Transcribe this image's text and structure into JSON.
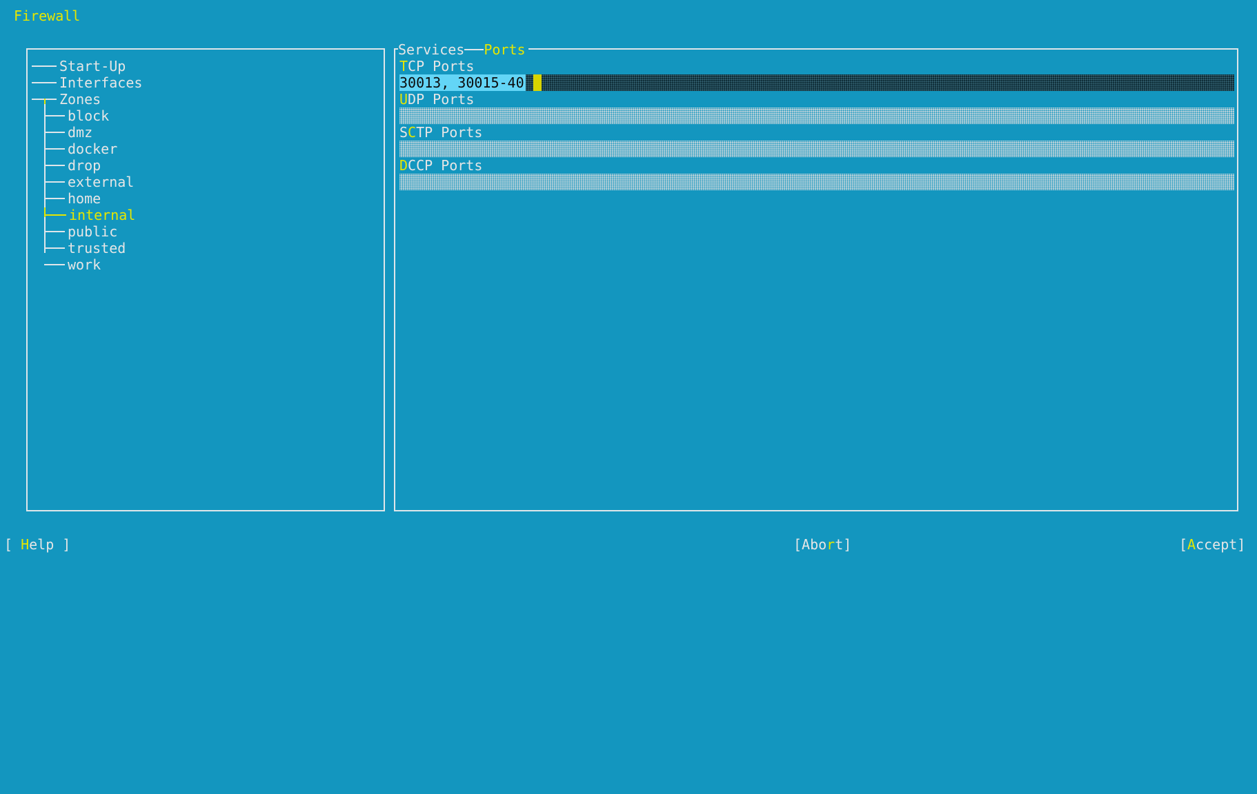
{
  "app": {
    "title": "Firewall"
  },
  "tree": {
    "top_items": [
      {
        "label": "Start-Up"
      },
      {
        "label": "Interfaces"
      },
      {
        "label": "Zones"
      }
    ],
    "zones": [
      {
        "label": "block"
      },
      {
        "label": "dmz"
      },
      {
        "label": "docker"
      },
      {
        "label": "drop"
      },
      {
        "label": "external"
      },
      {
        "label": "home"
      },
      {
        "label": "internal",
        "selected": true
      },
      {
        "label": "public"
      },
      {
        "label": "trusted"
      },
      {
        "label": "work"
      }
    ]
  },
  "tabs": {
    "services": "Services",
    "ports": "Ports",
    "active": "Ports"
  },
  "ports": {
    "tcp": {
      "hotkey": "T",
      "label_rest": "CP Ports",
      "value": "30013, 30015-40"
    },
    "udp": {
      "hotkey": "U",
      "label_rest": "DP Ports",
      "value": ""
    },
    "sctp": {
      "pre": "S",
      "hotkey": "C",
      "label_rest": "TP Ports",
      "value": ""
    },
    "dccp": {
      "hotkey": "D",
      "label_rest": "CCP Ports",
      "value": ""
    }
  },
  "buttons": {
    "help": {
      "open": "[ ",
      "hotkey": "H",
      "rest": "elp ]"
    },
    "abort": {
      "open": "[Abo",
      "hotkey": "r",
      "rest": "t]"
    },
    "accept": {
      "open": "[",
      "hotkey": "A",
      "rest": "ccept]"
    }
  },
  "colors": {
    "background": "#1396bf",
    "text": "#e6e6e6",
    "highlight": "#e6e600",
    "input_selected": "#63d5f6"
  }
}
